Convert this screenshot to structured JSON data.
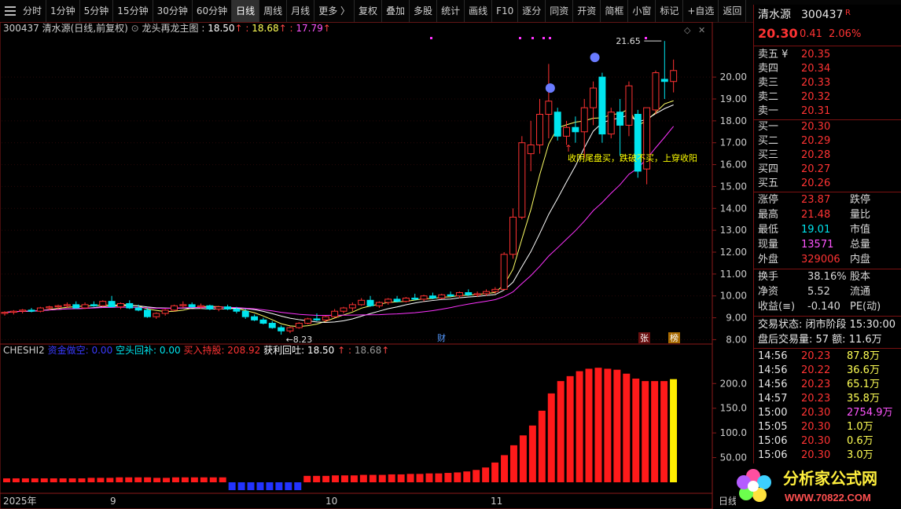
{
  "toolbar": {
    "items": [
      "分时",
      "1分钟",
      "5分钟",
      "15分钟",
      "30分钟",
      "60分钟",
      "日线",
      "周线",
      "月线",
      "更多 〉",
      "复权",
      "叠加",
      "多股",
      "统计",
      "画线",
      "F10",
      "逐分",
      "同资",
      "开资",
      "简框",
      "小窗",
      "标记",
      "+自选",
      "返回"
    ],
    "active": "日线"
  },
  "header": {
    "code": "300437",
    "name_mode": "清水源(日线,前复权)",
    "indicator": "龙头再龙主图",
    "v1": "18.50",
    "v2": "18.68",
    "v3": "17.79"
  },
  "colors": {
    "up": "#ff3232",
    "down": "#00e5ee",
    "ma1": "#ffff66",
    "ma2": "#ffffff",
    "ma3": "#ff33ff",
    "grid": "#8b1a1a"
  },
  "chart_data": {
    "type": "candlestick",
    "price_ticks": [
      "20.00",
      "19.00",
      "18.00",
      "17.00",
      "16.00",
      "15.00",
      "14.00",
      "13.00",
      "12.00",
      "11.00",
      "10.00",
      "9.00",
      "8.00"
    ],
    "price_range": [
      7.8,
      21.8
    ],
    "high_label": "21.65",
    "low_label": "8.23",
    "annotation": "收阴尾盘买，跌破不买，上穿收阳",
    "markers": {
      "cai": "财",
      "zhang": "张",
      "bang": "榜"
    },
    "candles": [
      [
        9.2,
        9.3,
        9.1,
        9.25
      ],
      [
        9.25,
        9.35,
        9.15,
        9.3
      ],
      [
        9.3,
        9.4,
        9.2,
        9.35
      ],
      [
        9.35,
        9.45,
        9.25,
        9.3
      ],
      [
        9.3,
        9.5,
        9.25,
        9.45
      ],
      [
        9.45,
        9.55,
        9.35,
        9.5
      ],
      [
        9.5,
        9.6,
        9.4,
        9.55
      ],
      [
        9.55,
        9.7,
        9.45,
        9.6
      ],
      [
        9.6,
        9.75,
        9.4,
        9.45
      ],
      [
        9.45,
        9.7,
        9.4,
        9.6
      ],
      [
        9.6,
        9.75,
        9.5,
        9.55
      ],
      [
        9.55,
        9.8,
        9.5,
        9.75
      ],
      [
        9.75,
        10.0,
        9.6,
        9.5
      ],
      [
        9.5,
        9.7,
        9.4,
        9.65
      ],
      [
        9.65,
        9.8,
        9.4,
        9.45
      ],
      [
        9.45,
        9.6,
        9.3,
        9.35
      ],
      [
        9.35,
        9.45,
        9.0,
        9.05
      ],
      [
        9.05,
        9.25,
        8.95,
        9.2
      ],
      [
        9.2,
        9.4,
        9.1,
        9.35
      ],
      [
        9.35,
        9.6,
        9.3,
        9.55
      ],
      [
        9.55,
        9.75,
        9.45,
        9.6
      ],
      [
        9.6,
        9.7,
        9.45,
        9.5
      ],
      [
        9.5,
        9.65,
        9.4,
        9.55
      ],
      [
        9.55,
        9.6,
        9.35,
        9.4
      ],
      [
        9.4,
        9.55,
        9.3,
        9.5
      ],
      [
        9.5,
        9.6,
        9.35,
        9.4
      ],
      [
        9.4,
        9.5,
        9.2,
        9.3
      ],
      [
        9.3,
        9.4,
        8.95,
        9.05
      ],
      [
        9.05,
        9.15,
        8.85,
        8.9
      ],
      [
        8.9,
        9.0,
        8.7,
        8.75
      ],
      [
        8.75,
        8.85,
        8.5,
        8.55
      ],
      [
        8.55,
        8.65,
        8.23,
        8.4
      ],
      [
        8.4,
        8.6,
        8.3,
        8.55
      ],
      [
        8.55,
        8.8,
        8.5,
        8.75
      ],
      [
        8.75,
        9.0,
        8.7,
        8.95
      ],
      [
        8.95,
        9.2,
        8.85,
        8.9
      ],
      [
        8.9,
        9.1,
        8.8,
        9.05
      ],
      [
        9.05,
        9.4,
        9.0,
        9.3
      ],
      [
        9.3,
        9.5,
        9.2,
        9.45
      ],
      [
        9.45,
        9.7,
        9.3,
        9.6
      ],
      [
        9.6,
        9.9,
        9.55,
        9.8
      ],
      [
        9.8,
        10.0,
        9.5,
        9.55
      ],
      [
        9.55,
        9.75,
        9.45,
        9.7
      ],
      [
        9.7,
        9.9,
        9.6,
        9.85
      ],
      [
        9.85,
        10.0,
        9.7,
        9.75
      ],
      [
        9.75,
        9.95,
        9.7,
        9.9
      ],
      [
        9.9,
        10.1,
        9.8,
        9.85
      ],
      [
        9.85,
        10.05,
        9.75,
        10.0
      ],
      [
        10.0,
        10.15,
        9.85,
        9.9
      ],
      [
        9.9,
        10.1,
        9.85,
        10.05
      ],
      [
        10.05,
        10.2,
        9.95,
        10.0
      ],
      [
        10.0,
        10.2,
        9.9,
        10.15
      ],
      [
        10.15,
        10.3,
        10.0,
        10.05
      ],
      [
        10.05,
        10.2,
        9.95,
        10.1
      ],
      [
        10.1,
        10.3,
        10.0,
        10.2
      ],
      [
        10.2,
        10.4,
        10.1,
        10.3
      ],
      [
        10.3,
        12.0,
        10.25,
        11.9
      ],
      [
        11.9,
        14.0,
        11.7,
        13.6
      ],
      [
        13.6,
        17.3,
        13.5,
        17.0
      ],
      [
        16.5,
        18.0,
        15.7,
        16.9
      ],
      [
        16.9,
        19.0,
        16.5,
        18.3
      ],
      [
        18.3,
        20.6,
        17.2,
        18.9
      ],
      [
        18.4,
        18.6,
        17.1,
        17.3
      ],
      [
        17.3,
        18.0,
        16.9,
        17.7
      ],
      [
        17.7,
        18.2,
        17.0,
        17.5
      ],
      [
        17.5,
        19.0,
        16.3,
        18.6
      ],
      [
        18.6,
        19.8,
        17.8,
        19.5
      ],
      [
        20.0,
        20.2,
        17.0,
        17.4
      ],
      [
        17.4,
        18.6,
        17.2,
        18.4
      ],
      [
        18.4,
        19.0,
        16.4,
        17.8
      ],
      [
        17.8,
        19.8,
        17.3,
        19.6
      ],
      [
        18.3,
        18.5,
        15.4,
        15.7
      ],
      [
        15.8,
        18.5,
        15.1,
        18.6
      ],
      [
        18.5,
        20.3,
        18.3,
        20.2
      ],
      [
        19.9,
        21.65,
        19.0,
        19.8
      ],
      [
        19.8,
        20.8,
        19.3,
        20.3
      ]
    ]
  },
  "sub": {
    "name": "CHESHI2",
    "labels": [
      "资金做空: 0.00",
      "空头回补: 0.00",
      "买入持股: 208.92",
      "获利回吐: 18.50",
      "18.68"
    ],
    "ticks": [
      "200.0",
      "150.0",
      "100.0",
      "50.00"
    ],
    "range": [
      0,
      245
    ],
    "bars": [
      8,
      8,
      8,
      8,
      8,
      8,
      8,
      8,
      8,
      9,
      9,
      9,
      10,
      10,
      10,
      10,
      9,
      9,
      10,
      10,
      10,
      10,
      10,
      10,
      10,
      11,
      11,
      11,
      12,
      12,
      12,
      13,
      13,
      13,
      13,
      14,
      14,
      14,
      15,
      15,
      15,
      16,
      16,
      17,
      17,
      18,
      18,
      19,
      20,
      22,
      25,
      30,
      40,
      55,
      75,
      95,
      115,
      145,
      180,
      205,
      215,
      225,
      230,
      232,
      230,
      228,
      220,
      210,
      205,
      205,
      205,
      208.92
    ]
  },
  "dates": [
    "2025年",
    "9",
    "10",
    "11",
    "日线"
  ],
  "quote": {
    "name": "清水源",
    "code": "300437",
    "tag": "R",
    "price": "20.30",
    "change": "0.41",
    "pct": "2.06%",
    "asks": [
      [
        "卖五 ¥",
        "20.35"
      ],
      [
        "卖四",
        "20.34"
      ],
      [
        "卖三",
        "20.33"
      ],
      [
        "卖二",
        "20.32"
      ],
      [
        "卖一",
        "20.31"
      ]
    ],
    "bids": [
      [
        "买一",
        "20.30"
      ],
      [
        "买二",
        "20.29"
      ],
      [
        "买三",
        "20.28"
      ],
      [
        "买四",
        "20.27"
      ],
      [
        "买五",
        "20.26"
      ]
    ],
    "stats": [
      [
        "涨停",
        "23.87",
        "跌停"
      ],
      [
        "最高",
        "21.48",
        "量比"
      ],
      [
        "最低",
        "19.01",
        "市值"
      ],
      [
        "现量",
        "13571",
        "总量"
      ],
      [
        "外盘",
        "329006",
        "内盘"
      ]
    ],
    "stats2": [
      [
        "换手",
        "38.16%",
        "股本"
      ],
      [
        "净资",
        "5.52",
        "流通"
      ],
      [
        "收益(≡)",
        "-0.140",
        "PE(动)"
      ]
    ],
    "status": "交易状态: 闭市阶段 15:30:00",
    "after": "盘后交易量: 57  额: 11.6万",
    "ticks": [
      [
        "14:56",
        "20.23",
        "87.8万"
      ],
      [
        "14:56",
        "20.22",
        "36.6万"
      ],
      [
        "14:56",
        "20.23",
        "65.1万"
      ],
      [
        "14:57",
        "20.23",
        "35.8万"
      ],
      [
        "15:00",
        "20.30",
        "2754.9万"
      ],
      [
        "15:05",
        "20.30",
        "1.0万"
      ],
      [
        "15:06",
        "20.30",
        "0.6万"
      ],
      [
        "15:06",
        "20.30",
        "3.0万"
      ]
    ]
  },
  "watermark": {
    "site": "分析家公式网",
    "url": "WWW.70822.COM"
  }
}
